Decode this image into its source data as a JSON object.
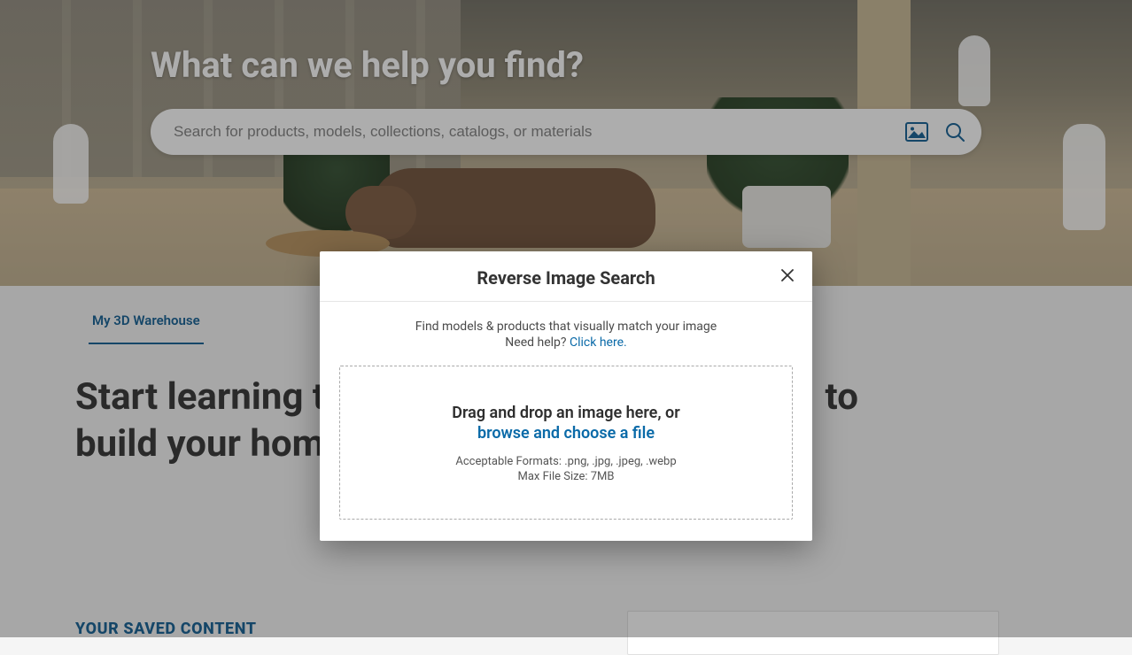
{
  "hero": {
    "title": "What can we help you find?",
    "search_placeholder": "Search for products, models, collections, catalogs, or materials"
  },
  "tabs": {
    "my_warehouse_label": "My 3D Warehouse"
  },
  "headline": {
    "line1": "Start learning th",
    "line2": "build your home",
    "trail1": "to"
  },
  "saved_content_heading": "YOUR SAVED CONTENT",
  "modal": {
    "title": "Reverse Image Search",
    "description": "Find models & products that visually match your image",
    "need_help_prefix": "Need help? ",
    "need_help_link": "Click here.",
    "drop_main": "Drag and drop an image here, or",
    "browse_label": "browse and choose a file",
    "formats": "Acceptable Formats: .png, .jpg, .jpeg, .webp",
    "max_size": "Max File Size: 7MB"
  }
}
